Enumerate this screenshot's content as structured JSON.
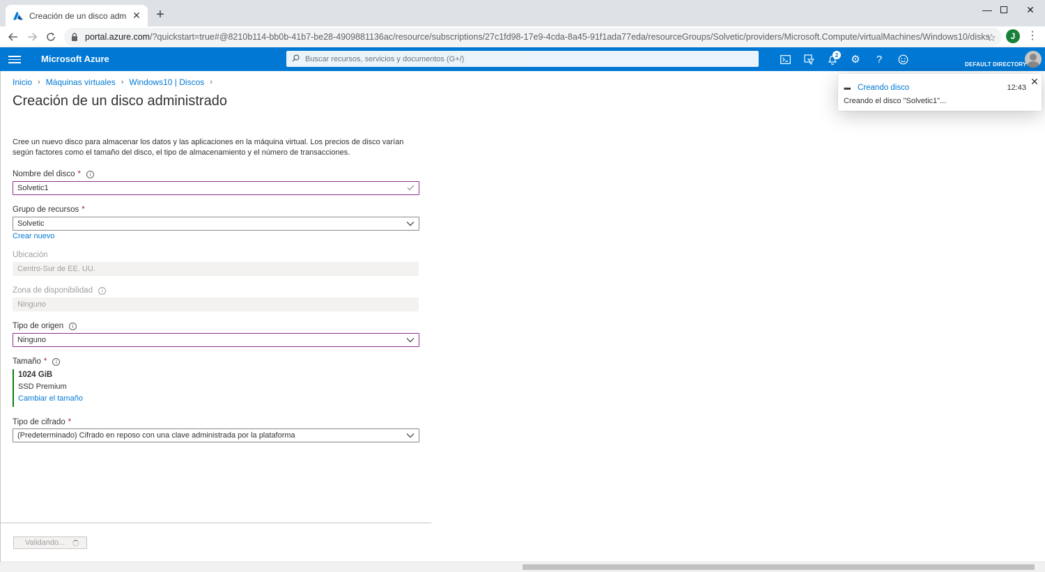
{
  "browser": {
    "tab_title": "Creación de un disco administrado",
    "url_host": "portal.azure.com",
    "url_path": "/?quickstart=true#@8210b114-bb0b-41b7-be28-4909881136ac/resource/subscriptions/27c1fd98-17e9-4cda-8a45-91f1ada77eda/resourceGroups/Solvetic/providers/Microsoft.Compute/virtualMachines/Windows10/disks",
    "profile_initial": "J"
  },
  "portal": {
    "brand": "Microsoft Azure",
    "search_placeholder": "Buscar recursos, servicios y documentos (G+/)",
    "notification_count": "2",
    "directory": "DEFAULT DIRECTORY",
    "accent_color": "#0078d4"
  },
  "breadcrumb": {
    "items": [
      "Inicio",
      "Máquinas virtuales",
      "Windows10 | Discos"
    ]
  },
  "page": {
    "title": "Creación de un disco administrado",
    "description": "Cree un nuevo disco para almacenar los datos y las aplicaciones en la máquina virtual. Los precios de disco varían según factores como el tamaño del disco, el tipo de almacenamiento y el número de transacciones."
  },
  "form": {
    "disk_name": {
      "label": "Nombre del disco",
      "value": "Solvetic1"
    },
    "resource_group": {
      "label": "Grupo de recursos",
      "value": "Solvetic",
      "create_new": "Crear nuevo"
    },
    "location": {
      "label": "Ubicación",
      "value": "Centro-Sur de EE. UU."
    },
    "availability_zone": {
      "label": "Zona de disponibilidad",
      "value": "Ninguno"
    },
    "source_type": {
      "label": "Tipo de origen",
      "value": "Ninguno"
    },
    "size": {
      "label": "Tamaño",
      "value": "1024 GiB",
      "sku": "SSD Premium",
      "change_link": "Cambiar el tamaño"
    },
    "encryption": {
      "label": "Tipo de cifrado",
      "value": "(Predeterminado) Cifrado en reposo con una clave administrada por la plataforma"
    },
    "required_mark": "*"
  },
  "footer": {
    "validate_label": "Validando..."
  },
  "notification": {
    "title": "Creando disco",
    "time": "12:43",
    "message": "Creando el disco \"Solvetic1\"..."
  }
}
